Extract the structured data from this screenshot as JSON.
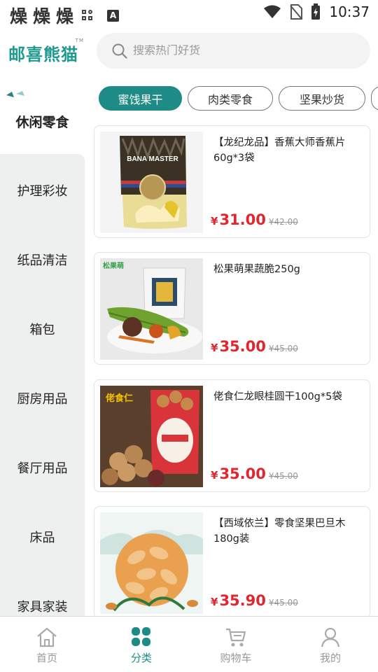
{
  "status_bar": {
    "glyphs": [
      "燥",
      "燥",
      "燥"
    ],
    "time": "10:37"
  },
  "header": {
    "logo": "邮喜熊猫",
    "logo_tm": "TM",
    "search": {
      "placeholder": "搜索热门好货",
      "value": ""
    }
  },
  "sidebar": {
    "items": [
      {
        "label": "休闲零食",
        "active": true
      },
      {
        "label": "护理彩妆"
      },
      {
        "label": "纸品清洁"
      },
      {
        "label": "箱包"
      },
      {
        "label": "厨房用品"
      },
      {
        "label": "餐厅用品"
      },
      {
        "label": "床品"
      },
      {
        "label": "家具家装"
      }
    ]
  },
  "chips": [
    {
      "label": "蜜饯果干",
      "active": true
    },
    {
      "label": "肉类零食"
    },
    {
      "label": "坚果炒货"
    }
  ],
  "products": [
    {
      "name": "【龙纪龙品】香蕉大师香蕉片60g*3袋",
      "currency": "¥",
      "price": "31.00",
      "original_price": "¥42.00",
      "package_text": "BANA MASTER"
    },
    {
      "name": "松果萌果蔬脆250g",
      "currency": "¥",
      "price": "35.00",
      "original_price": "¥45.00",
      "package_text": "松果萌"
    },
    {
      "name": "佬食仁龙眼桂圆干100g*5袋",
      "currency": "¥",
      "price": "35.00",
      "original_price": "¥45.00",
      "package_text": "佬食仁"
    },
    {
      "name": "【西域依兰】零食坚果巴旦木180g装",
      "currency": "¥",
      "price": "35.90",
      "original_price": "¥45.00",
      "package_text": ""
    }
  ],
  "tabbar": {
    "items": [
      {
        "label": "首页",
        "icon": "home-icon"
      },
      {
        "label": "分类",
        "icon": "category-icon",
        "active": true
      },
      {
        "label": "购物车",
        "icon": "cart-icon"
      },
      {
        "label": "我的",
        "icon": "user-icon"
      }
    ]
  },
  "colors": {
    "accent": "#1f8b86",
    "price": "#e0262f",
    "sidebar_bg": "#eef0ef"
  }
}
